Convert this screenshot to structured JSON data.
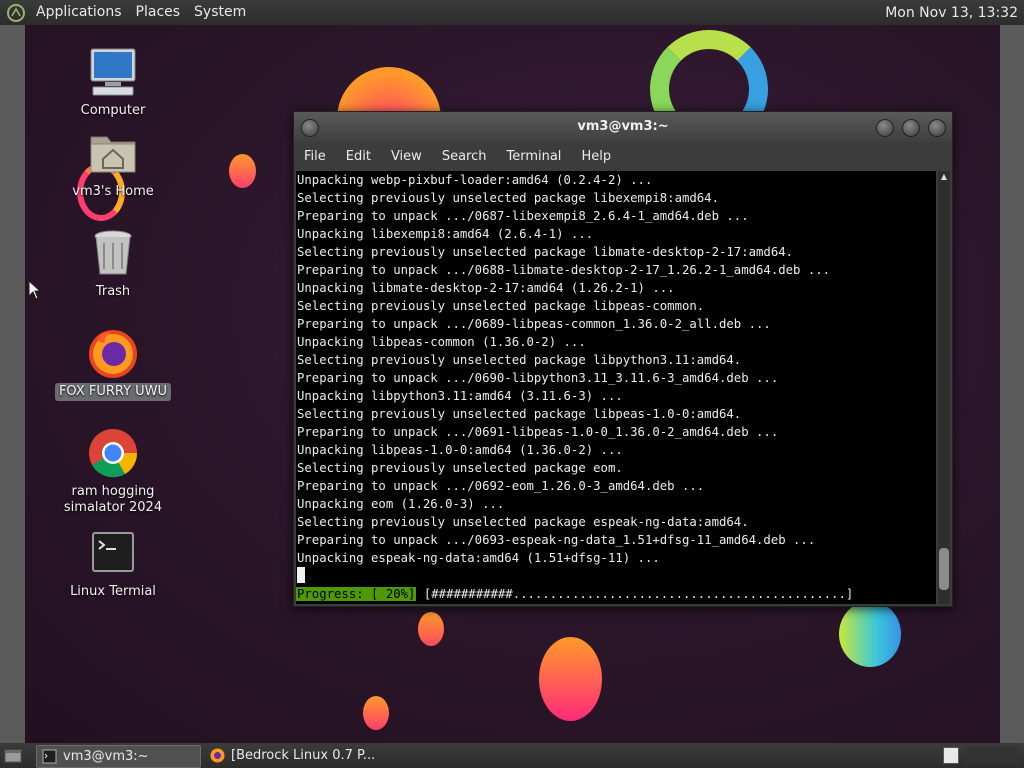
{
  "top_panel": {
    "menus": [
      "Applications",
      "Places",
      "System"
    ],
    "clock": "Mon Nov 13, 13:32"
  },
  "desktop_icons": [
    {
      "label": "Computer",
      "icon": "computer-icon"
    },
    {
      "label": "vm3's Home",
      "icon": "home-folder-icon"
    },
    {
      "label": "Trash",
      "icon": "trash-icon"
    },
    {
      "label": "FOX FURRY UWU",
      "icon": "firefox-icon",
      "selected": true
    },
    {
      "label": "ram hogging\nsimalator 2024",
      "icon": "chrome-icon"
    },
    {
      "label": "Linux Termial",
      "icon": "terminal-icon"
    }
  ],
  "terminal": {
    "title": "vm3@vm3:~",
    "menus": [
      "File",
      "Edit",
      "View",
      "Search",
      "Terminal",
      "Help"
    ],
    "lines": [
      "Unpacking webp-pixbuf-loader:amd64 (0.2.4-2) ...",
      "Selecting previously unselected package libexempi8:amd64.",
      "Preparing to unpack .../0687-libexempi8_2.6.4-1_amd64.deb ...",
      "Unpacking libexempi8:amd64 (2.6.4-1) ...",
      "Selecting previously unselected package libmate-desktop-2-17:amd64.",
      "Preparing to unpack .../0688-libmate-desktop-2-17_1.26.2-1_amd64.deb ...",
      "Unpacking libmate-desktop-2-17:amd64 (1.26.2-1) ...",
      "Selecting previously unselected package libpeas-common.",
      "Preparing to unpack .../0689-libpeas-common_1.36.0-2_all.deb ...",
      "Unpacking libpeas-common (1.36.0-2) ...",
      "Selecting previously unselected package libpython3.11:amd64.",
      "Preparing to unpack .../0690-libpython3.11_3.11.6-3_amd64.deb ...",
      "Unpacking libpython3.11:amd64 (3.11.6-3) ...",
      "Selecting previously unselected package libpeas-1.0-0:amd64.",
      "Preparing to unpack .../0691-libpeas-1.0-0_1.36.0-2_amd64.deb ...",
      "Unpacking libpeas-1.0-0:amd64 (1.36.0-2) ...",
      "Selecting previously unselected package eom.",
      "Preparing to unpack .../0692-eom_1.26.0-3_amd64.deb ...",
      "Unpacking eom (1.26.0-3) ...",
      "Selecting previously unselected package espeak-ng-data:amd64.",
      "Preparing to unpack .../0693-espeak-ng-data_1.51+dfsg-11_amd64.deb ...",
      "Unpacking espeak-ng-data:amd64 (1.51+dfsg-11) ..."
    ],
    "progress_label": "Progress: [ 20%]",
    "progress_bar": " [###########.............................................]",
    "progress_fraction": 0.2
  },
  "taskbar": {
    "tasks": [
      {
        "label": "vm3@vm3:~",
        "active": true
      },
      {
        "label": "[Bedrock Linux 0.7 P...",
        "active": false
      }
    ]
  },
  "colors": {
    "panel": "#2f2f2f",
    "progress_green": "#4e9a06",
    "desktop_bg": "#2a1628"
  }
}
